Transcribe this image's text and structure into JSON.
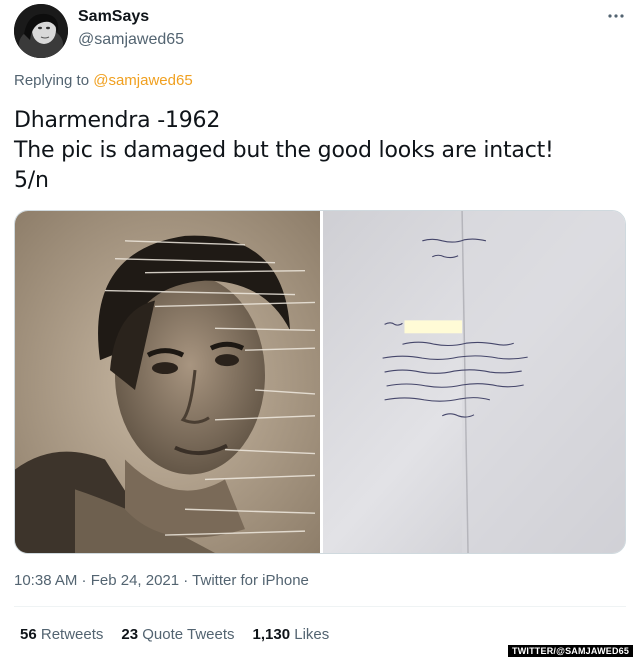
{
  "author": {
    "display_name": "SamSays",
    "handle": "@samjawed65",
    "avatar": "profile-photo"
  },
  "more_icon": "more-horizontal-icon",
  "reply": {
    "prefix": "Replying to ",
    "mention": "@samjawed65"
  },
  "tweet": {
    "lines": [
      "Dharmendra -1962",
      "The pic is damaged but the good looks are intact!",
      "5/n"
    ]
  },
  "media": {
    "images": [
      "damaged sepia portrait photograph",
      "handwritten letter on paper"
    ]
  },
  "meta": {
    "timestamp": "10:38 AM · Feb 24, 2021 · Twitter for iPhone"
  },
  "stats": {
    "retweets_count": "56",
    "retweets_label": "Retweets",
    "quotes_count": "23",
    "quotes_label": "Quote Tweets",
    "likes_count": "1,130",
    "likes_label": "Likes"
  },
  "watermark": "TWITTER/@SAMJAWED65",
  "colors": {
    "text": "#0f1419",
    "secondary": "#536471",
    "mention": "#f0a020",
    "border": "#cfd9de"
  }
}
